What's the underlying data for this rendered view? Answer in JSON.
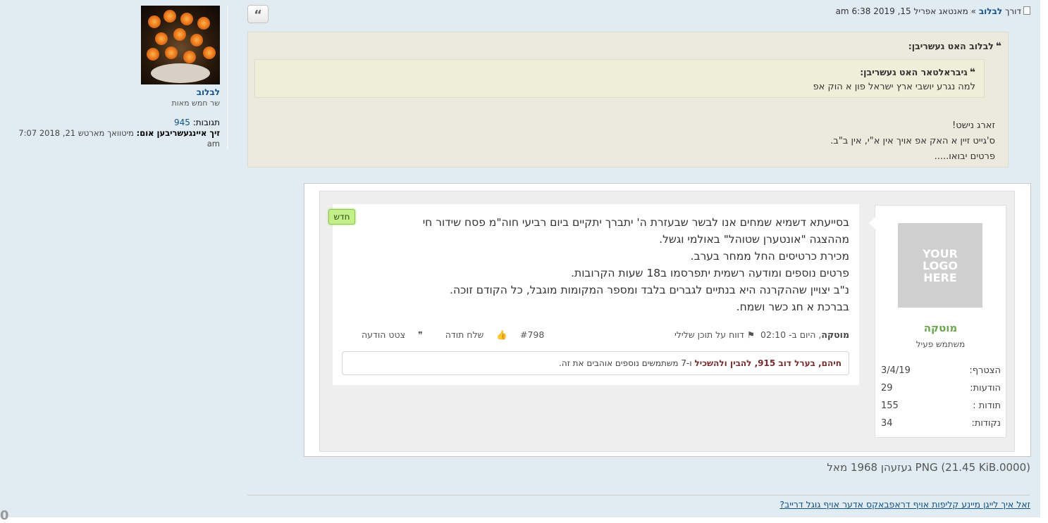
{
  "profile": {
    "username": "לבלוב",
    "rank": "שר חמש מאות",
    "posts_label": "תגובות:",
    "posts_value": "945",
    "joined_label": "זיך איינגעשריבען אום:",
    "joined_value": "מיטוואך מארטש 21, 2018 7:07 am"
  },
  "post_header": {
    "by_label": "דורך",
    "author": "לבלוב",
    "sep": "»",
    "date": "מאנטאג אפריל 15, 2019 6:38 am",
    "quote_glyph": "“"
  },
  "outer_quote": {
    "quote_mark": "❝",
    "header": "לבלוב האט געשריבן:",
    "inner_header": "גיבראלטאר האט געשריבן:",
    "inner_text": "למה נגרע יושבי ארץ ישראל פון א הוק אפ",
    "lines": [
      "זארג נישט!",
      "ס'גייט זיין א האק אפ אויך אין א\"י, אין ב\"ב.",
      "פרטים יבואו....."
    ]
  },
  "image": {
    "new_badge": "חדש",
    "message_lines": [
      "בסייעתא דשמיא שמחים אנו לבשר שבעזרת ה' יתברך יתקיים ביום רביעי חוה\"מ פסח שידור חי",
      "מההצגה \"אונטערן שטוהל\" באולמי וגשל.",
      "מכירת כרטיסים החל ממחר בערב.",
      "פרטים נוספים ומודעה רשמית יתפרסמו ב18 שעות הקרובות.",
      "נ\"ב יצויין שההקרנה היא בנתיים לגברים בלבד ומספר המקומות מוגבל, כל הקודם זוכה.",
      "בברכת א חג כשר ושמח."
    ],
    "meta_author": "מוטקה",
    "meta_time": ", היום ב- 02:10",
    "report_label": "דווח על תוכן שלילי",
    "post_num": "#798",
    "thanks_label": "שלח תודה",
    "quote_label": "צטט הודעה",
    "likes_names": "חיהם, בערל דוב 915, להבין ולהשכיל",
    "likes_rest": "ו-7 משתמשים נוספים אוהבים את זה.",
    "logo_text": [
      "YOUR",
      "LOGO",
      "HERE"
    ],
    "card_name": "מוטקה",
    "card_rank": "משתמש פעיל",
    "card_rows": [
      {
        "k": "הצטרף:",
        "v": "3/4/19"
      },
      {
        "k": "הודעות:",
        "v": "29"
      },
      {
        "k": "תודות :",
        "v": "155"
      },
      {
        "k": "נקודות:",
        "v": "34"
      }
    ]
  },
  "caption": "(PNG (21.45 KiB.0000 געזעהן 1968 מאל",
  "bottom_link": "זאל איך לייגן מיינע קליפות אויף דראפבאקס אדער אויף גוגל דרייב?",
  "stray_char": "0"
}
